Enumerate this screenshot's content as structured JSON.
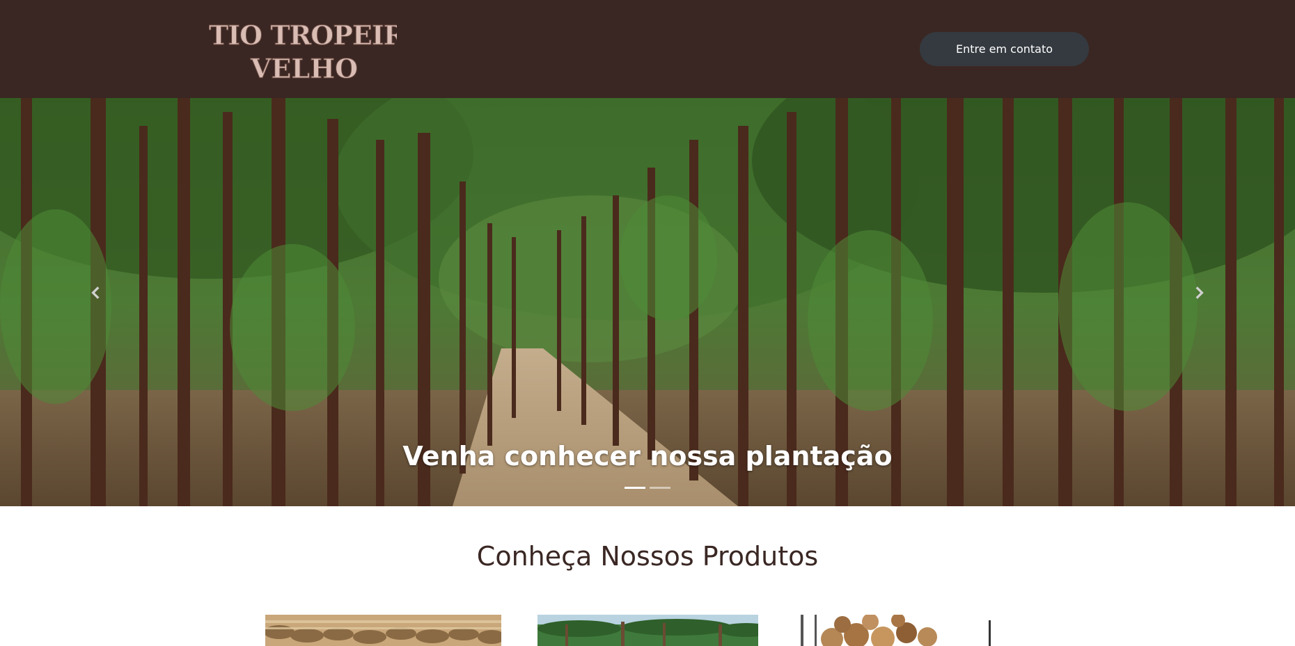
{
  "header": {
    "logo_line1": "SITIO TROPEIRO",
    "logo_line2": "VELHO",
    "contact_button": "Entre em contato"
  },
  "carousel": {
    "caption": "Venha conhecer nossa plantação",
    "slides": 2,
    "active_slide": 1,
    "prev_icon": "chevron-left-icon",
    "next_icon": "chevron-right-icon"
  },
  "products": {
    "title": "Conheça Nossos Produtos"
  },
  "colors": {
    "header_bg": "#3a2723",
    "button_bg": "#343a40",
    "title_color": "#3a2723"
  }
}
